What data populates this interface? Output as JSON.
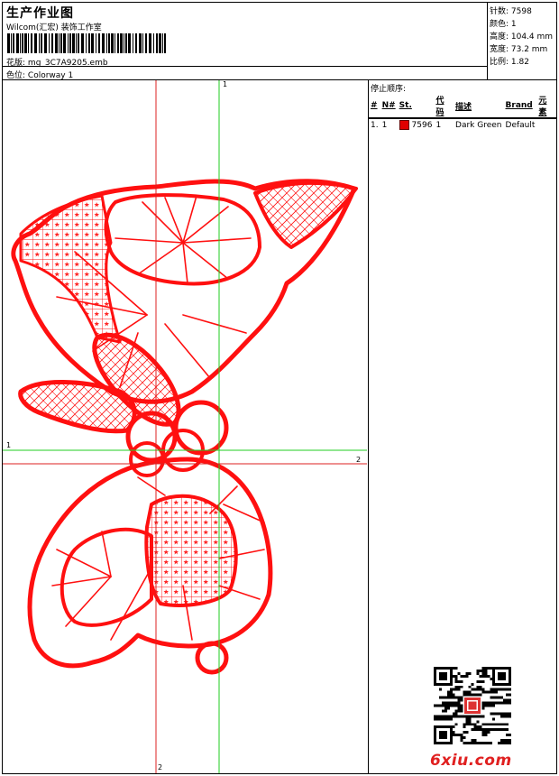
{
  "header": {
    "title": "生产作业图",
    "studio": "Wilcom(汇宏) 装饰工作室",
    "design_label": "花版:",
    "design_file": "mg_3C7A9205.emb",
    "colorway_label": "色位:",
    "colorway": "Colorway 1"
  },
  "stats": {
    "stitches": "针数: 7598",
    "colors": "颜色: 1",
    "height": "高度: 104.4 mm",
    "width": "宽度: 73.2 mm",
    "scale": "比例: 1.82"
  },
  "stop_sequence": {
    "title": "停止顺序:",
    "columns": [
      "#",
      "N#",
      "St.",
      "代码",
      "描述",
      "Brand",
      "元素"
    ],
    "rows": [
      {
        "num": "1.",
        "n": "1",
        "st": "7596",
        "code": "1",
        "desc": "Dark Green",
        "brand": "Default",
        "element": ""
      }
    ]
  },
  "axes": {
    "v_top": "1",
    "h_left": "1",
    "h_right": "2",
    "v_bottom": "2"
  },
  "colors": {
    "thread": "#ff1010",
    "guide_green": "#22cc22",
    "guide_red": "#dd2020"
  },
  "watermark": "6xiu.com"
}
